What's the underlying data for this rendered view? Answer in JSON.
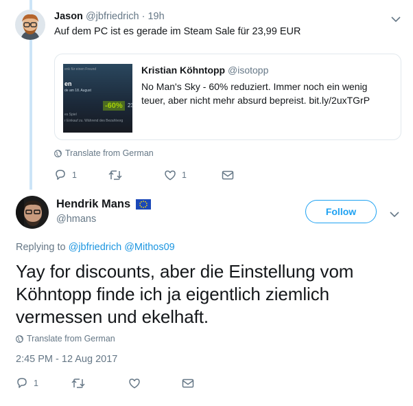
{
  "reply_tweet": {
    "author_name": "Jason",
    "author_handle": "@jbfriedrich",
    "separator": "·",
    "time": "19h",
    "text": "Auf dem PC ist es gerade im Steam Sale für 23,99 EUR",
    "quoted": {
      "author_name": "Kristian Köhntopp",
      "author_handle": "@isotopp",
      "text": "No Man's Sky - 60% reduziert. Immer noch ein wenig teuer, aber nicht mehr absurd bepreist. bit.ly/2uxTGrP",
      "image": {
        "line1": "enk für einen Freund",
        "line2": "en",
        "line3": "de am 18. August",
        "discount": "-60%",
        "price_fragment": "23",
        "line4": "es Spiel",
        "line5": "r Einkauf zu. Während des Bezahlvorg"
      }
    },
    "translate_label": "Translate from German",
    "actions": {
      "replies": "1",
      "retweets": "",
      "likes": "1"
    }
  },
  "main_tweet": {
    "author_name": "Hendrik Mans",
    "author_handle": "@hmans",
    "follow_label": "Follow",
    "replying_prefix": "Replying to",
    "replying_users": [
      "@jbfriedrich",
      "@Mithos09"
    ],
    "text": "Yay for discounts, aber die Einstellung vom Köhntopp finde ich ja eigentlich ziemlich vermessen und ekelhaft.",
    "translate_label": "Translate from German",
    "timestamp": "2:45 PM - 12 Aug 2017",
    "actions": {
      "replies": "1",
      "retweets": "",
      "likes": ""
    }
  },
  "colors": {
    "accent": "#1da1f2",
    "link": "#1b95e0",
    "muted": "#657786",
    "thread_line": "#cce4f7",
    "border": "#e1e8ed"
  }
}
